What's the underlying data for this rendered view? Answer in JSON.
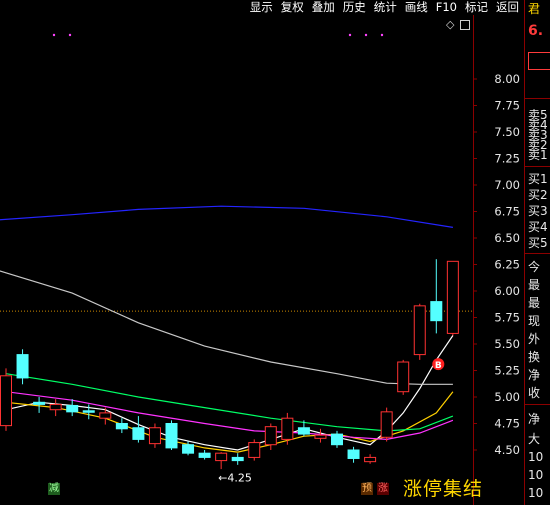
{
  "toolbar": {
    "items": [
      "显示",
      "复权",
      "叠加",
      "历史",
      "统计",
      "画线",
      "F10",
      "标记",
      "返回"
    ]
  },
  "right_panel": {
    "symbol": "君",
    "price": "6.",
    "labels": [
      "卖5",
      "卖4",
      "卖3",
      "卖2",
      "卖1",
      "买1",
      "买2",
      "买3",
      "买4",
      "买5",
      "今",
      "最",
      "最",
      "现",
      "外",
      "换",
      "净",
      "收",
      "净",
      "大",
      "10",
      "10",
      "10"
    ]
  },
  "chart_data": {
    "type": "candlestick",
    "y_ticks": [
      "8.00",
      "7.75",
      "7.50",
      "7.25",
      "7.00",
      "6.75",
      "6.50",
      "6.25",
      "6.00",
      "5.75",
      "5.50",
      "5.25",
      "5.00",
      "4.75",
      "4.50"
    ],
    "ylim": [
      4.35,
      8.25
    ],
    "reference_line": 5.81,
    "low_marker": "←4.25",
    "buy_marker": "B",
    "candles": [
      {
        "o": 5.2,
        "h": 5.27,
        "l": 4.68,
        "c": 4.73,
        "dir": "up"
      },
      {
        "o": 5.18,
        "h": 5.45,
        "l": 5.12,
        "c": 5.4,
        "dir": "down"
      },
      {
        "o": 4.93,
        "h": 5.0,
        "l": 4.85,
        "c": 4.95,
        "dir": "down"
      },
      {
        "o": 4.93,
        "h": 4.98,
        "l": 4.82,
        "c": 4.88,
        "dir": "up"
      },
      {
        "o": 4.92,
        "h": 4.98,
        "l": 4.82,
        "c": 4.86,
        "dir": "down"
      },
      {
        "o": 4.87,
        "h": 4.93,
        "l": 4.79,
        "c": 4.86,
        "dir": "down"
      },
      {
        "o": 4.85,
        "h": 4.9,
        "l": 4.74,
        "c": 4.8,
        "dir": "up"
      },
      {
        "o": 4.75,
        "h": 4.8,
        "l": 4.66,
        "c": 4.7,
        "dir": "down"
      },
      {
        "o": 4.71,
        "h": 4.82,
        "l": 4.57,
        "c": 4.6,
        "dir": "down"
      },
      {
        "o": 4.71,
        "h": 4.75,
        "l": 4.52,
        "c": 4.56,
        "dir": "up"
      },
      {
        "o": 4.75,
        "h": 4.78,
        "l": 4.5,
        "c": 4.52,
        "dir": "down"
      },
      {
        "o": 4.55,
        "h": 4.58,
        "l": 4.45,
        "c": 4.47,
        "dir": "down"
      },
      {
        "o": 4.47,
        "h": 4.5,
        "l": 4.41,
        "c": 4.43,
        "dir": "down"
      },
      {
        "o": 4.4,
        "h": 4.48,
        "l": 4.32,
        "c": 4.47,
        "dir": "up"
      },
      {
        "o": 4.43,
        "h": 4.47,
        "l": 4.36,
        "c": 4.4,
        "dir": "down"
      },
      {
        "o": 4.43,
        "h": 4.6,
        "l": 4.4,
        "c": 4.57,
        "dir": "up"
      },
      {
        "o": 4.55,
        "h": 4.75,
        "l": 4.5,
        "c": 4.72,
        "dir": "up"
      },
      {
        "o": 4.6,
        "h": 4.85,
        "l": 4.55,
        "c": 4.8,
        "dir": "up"
      },
      {
        "o": 4.71,
        "h": 4.78,
        "l": 4.63,
        "c": 4.65,
        "dir": "down"
      },
      {
        "o": 4.61,
        "h": 4.7,
        "l": 4.57,
        "c": 4.64,
        "dir": "up"
      },
      {
        "o": 4.65,
        "h": 4.68,
        "l": 4.52,
        "c": 4.55,
        "dir": "down"
      },
      {
        "o": 4.5,
        "h": 4.53,
        "l": 4.38,
        "c": 4.42,
        "dir": "down"
      },
      {
        "o": 4.43,
        "h": 4.46,
        "l": 4.37,
        "c": 4.39,
        "dir": "up"
      },
      {
        "o": 4.62,
        "h": 4.9,
        "l": 4.58,
        "c": 4.86,
        "dir": "up"
      },
      {
        "o": 5.05,
        "h": 5.35,
        "l": 5.02,
        "c": 5.33,
        "dir": "up"
      },
      {
        "o": 5.4,
        "h": 5.88,
        "l": 5.35,
        "c": 5.86,
        "dir": "up"
      },
      {
        "o": 5.72,
        "h": 6.3,
        "l": 5.6,
        "c": 5.9,
        "dir": "down"
      },
      {
        "o": 5.6,
        "h": 6.28,
        "l": 5.58,
        "c": 6.28,
        "dir": "up"
      }
    ],
    "ma_lines": [
      {
        "color": "#ffffff",
        "points": [
          [
            0,
            4.88
          ],
          [
            2,
            4.95
          ],
          [
            4,
            4.92
          ],
          [
            6,
            4.88
          ],
          [
            8,
            4.74
          ],
          [
            10,
            4.62
          ],
          [
            12,
            4.55
          ],
          [
            14,
            4.5
          ],
          [
            16,
            4.6
          ],
          [
            18,
            4.7
          ],
          [
            20,
            4.62
          ],
          [
            22,
            4.55
          ],
          [
            23,
            4.68
          ],
          [
            24,
            4.85
          ],
          [
            25,
            5.08
          ],
          [
            26,
            5.35
          ],
          [
            27,
            5.58
          ]
        ]
      },
      {
        "color": "#ffd000",
        "points": [
          [
            0,
            4.95
          ],
          [
            3,
            4.9
          ],
          [
            6,
            4.8
          ],
          [
            9,
            4.62
          ],
          [
            12,
            4.52
          ],
          [
            14,
            4.48
          ],
          [
            16,
            4.55
          ],
          [
            18,
            4.63
          ],
          [
            20,
            4.65
          ],
          [
            22,
            4.58
          ],
          [
            24,
            4.68
          ],
          [
            26,
            4.85
          ],
          [
            27,
            5.05
          ]
        ]
      },
      {
        "color": "#ff33ff",
        "points": [
          [
            0,
            5.05
          ],
          [
            4,
            4.97
          ],
          [
            8,
            4.85
          ],
          [
            12,
            4.75
          ],
          [
            15,
            4.68
          ],
          [
            18,
            4.66
          ],
          [
            21,
            4.62
          ],
          [
            23,
            4.6
          ],
          [
            25,
            4.66
          ],
          [
            27,
            4.78
          ]
        ]
      },
      {
        "color": "#00ff66",
        "points": [
          [
            0,
            5.22
          ],
          [
            4,
            5.12
          ],
          [
            8,
            5.0
          ],
          [
            12,
            4.9
          ],
          [
            16,
            4.8
          ],
          [
            20,
            4.72
          ],
          [
            23,
            4.68
          ],
          [
            25,
            4.7
          ],
          [
            27,
            4.82
          ]
        ]
      },
      {
        "color": "#c8c8c8",
        "points": [
          [
            -0.6,
            6.2
          ],
          [
            4,
            5.98
          ],
          [
            8,
            5.7
          ],
          [
            12,
            5.48
          ],
          [
            16,
            5.33
          ],
          [
            20,
            5.22
          ],
          [
            23,
            5.13
          ],
          [
            25,
            5.12
          ],
          [
            27,
            5.12
          ]
        ]
      },
      {
        "color": "#2424ff",
        "points": [
          [
            -0.6,
            6.67
          ],
          [
            4,
            6.72
          ],
          [
            8,
            6.77
          ],
          [
            13,
            6.8
          ],
          [
            18,
            6.78
          ],
          [
            23,
            6.7
          ],
          [
            27,
            6.6
          ]
        ]
      }
    ]
  },
  "status": {
    "left_badge": "减",
    "pre_badge": "预",
    "limit_badge": "涨",
    "limit_text": "涨停集结"
  }
}
